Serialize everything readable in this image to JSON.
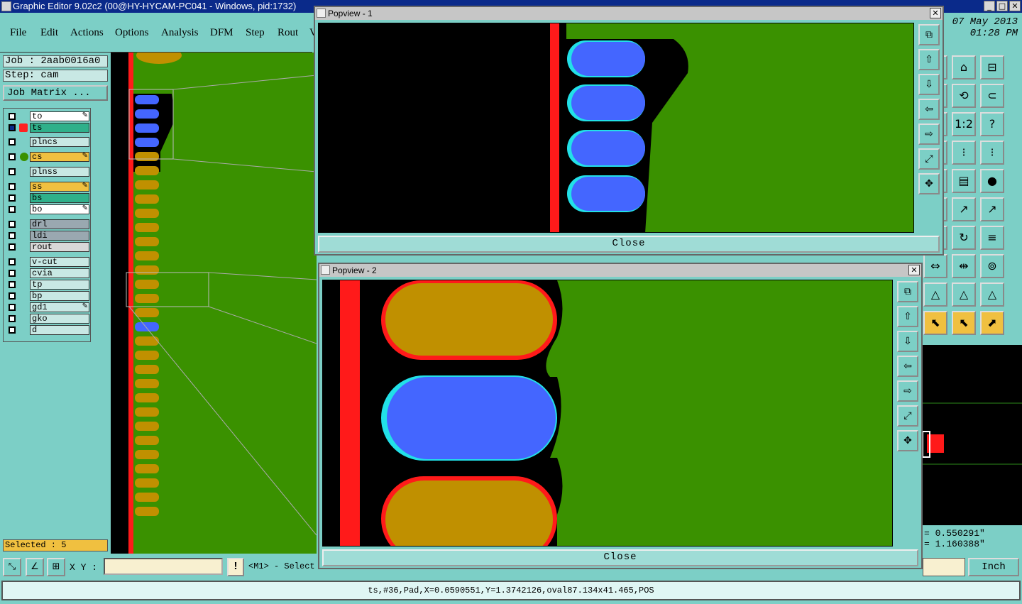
{
  "window": {
    "title": "Graphic Editor 9.02c2 (00@HY-HYCAM-PC041 - Windows, pid:1732)",
    "min": "_",
    "max": "□",
    "close": "✕"
  },
  "menu": {
    "items": [
      "File",
      "Edit",
      "Actions",
      "Options",
      "Analysis",
      "DFM",
      "Step",
      "Rout",
      "V"
    ]
  },
  "datetime": {
    "date": "07 May 2013",
    "time": "01:28 PM"
  },
  "job": {
    "job": "Job : 2aab0016a0",
    "step": "Step: cam",
    "matrix_button": "Job Matrix ..."
  },
  "layers": [
    {
      "name": "to",
      "color": "#ffffff",
      "active": false,
      "edit": true
    },
    {
      "name": "ts",
      "color": "#2fb08a",
      "active": true,
      "edit": false
    },
    {
      "name": "plncs",
      "color": "#c8e8e4",
      "active": false,
      "edit": false
    },
    {
      "name": "cs",
      "color": "#f0c040",
      "active": false,
      "edit": true
    },
    {
      "name": "plnss",
      "color": "#c8e8e4",
      "active": false,
      "edit": false
    },
    {
      "name": "ss",
      "color": "#f0c040",
      "active": false,
      "edit": true
    },
    {
      "name": "bs",
      "color": "#2fb08a",
      "active": false,
      "edit": false
    },
    {
      "name": "bo",
      "color": "#ffffff",
      "active": false,
      "edit": true
    },
    {
      "name": "drl",
      "color": "#9aa8b0",
      "active": false,
      "edit": false
    },
    {
      "name": "ldi",
      "color": "#9aa8b0",
      "active": false,
      "edit": false
    },
    {
      "name": "rout",
      "color": "#d8d8d8",
      "active": false,
      "edit": false
    },
    {
      "name": "v-cut",
      "color": "#c8e8e4",
      "active": false,
      "edit": false
    },
    {
      "name": "cvia",
      "color": "#c8e8e4",
      "active": false,
      "edit": false
    },
    {
      "name": "tp",
      "color": "#c8e8e4",
      "active": false,
      "edit": false
    },
    {
      "name": "bp",
      "color": "#c8e8e4",
      "active": false,
      "edit": false
    },
    {
      "name": "gd1",
      "color": "#c8e8e4",
      "active": false,
      "edit": true
    },
    {
      "name": "gko",
      "color": "#c8e8e4",
      "active": false,
      "edit": false
    },
    {
      "name": "d",
      "color": "#c8e8e4",
      "active": false,
      "edit": false
    }
  ],
  "selected": "Selected : 5",
  "popview1": {
    "title": "Popview - 1",
    "close_label": "Close"
  },
  "popview2": {
    "title": "Popview - 2",
    "close_label": "Close"
  },
  "coords": {
    "x": "0.550291\"",
    "y": "1.160388\""
  },
  "bottom": {
    "xy_label": "X Y :",
    "xy_value": "",
    "hint": "<M1> - Select",
    "unit": "Inch",
    "excl": "!"
  },
  "status": "ts,#36,Pad,X=0.0590551,Y=1.3742126,oval87.134x41.465,POS",
  "colors": {
    "board": "#3a9100",
    "pad_gold": "#c09000",
    "pad_blue": "#4466ff",
    "cyan": "#22e0e8",
    "red": "#ff1a1a"
  }
}
